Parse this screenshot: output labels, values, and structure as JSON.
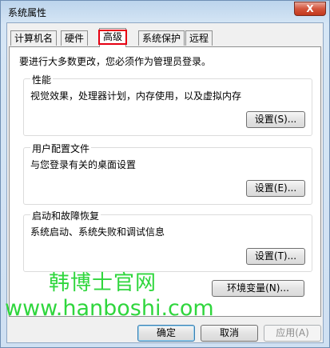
{
  "window": {
    "title": "系统属性",
    "close_label": "X"
  },
  "tabs": [
    {
      "label": "计算机名"
    },
    {
      "label": "硬件"
    },
    {
      "label": "高级"
    },
    {
      "label": "系统保护"
    },
    {
      "label": "远程"
    }
  ],
  "admin_note": "要进行大多数更改，您必须作为管理员登录。",
  "groups": {
    "performance": {
      "title": "性能",
      "desc": "视觉效果，处理器计划，内存使用，以及虚拟内存",
      "button": "设置(S)..."
    },
    "profiles": {
      "title": "用户配置文件",
      "desc": "与您登录有关的桌面设置",
      "button": "设置(E)..."
    },
    "startup": {
      "title": "启动和故障恢复",
      "desc": "系统启动、系统失败和调试信息",
      "button": "设置(T)..."
    }
  },
  "env_button": "环境变量(N)...",
  "footer": {
    "ok": "确定",
    "cancel": "取消",
    "apply": "应用(A)"
  },
  "watermark": {
    "line1": "韩博士官网",
    "line2": "www.hanboshi.com"
  }
}
